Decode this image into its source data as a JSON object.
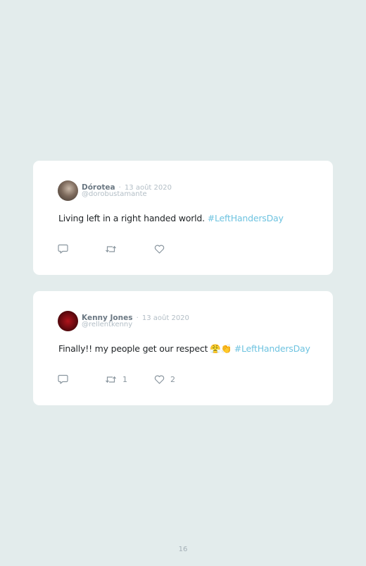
{
  "tweets": [
    {
      "author": "Dórotea",
      "separator": "·",
      "date": "13 août 2020",
      "handle": "@dorobustamante",
      "text": "Living left in a right handed world.",
      "hashtag": "#LeftHandersDay",
      "emoji": "",
      "retweets": "",
      "likes": ""
    },
    {
      "author": "Kenny Jones",
      "separator": "·",
      "date": "13 août 2020",
      "handle": "@rellentkenny",
      "text": "Finally!! my people get our respect",
      "emoji": "😤👏",
      "hashtag": "#LeftHandersDay",
      "retweets": "1",
      "likes": "2"
    }
  ],
  "page_number": "16",
  "colors": {
    "background": "#e3ecec",
    "card": "#ffffff",
    "hashtag": "#6ec3e0",
    "icon": "#8a969f"
  },
  "icons": {
    "reply": "reply-icon",
    "retweet": "retweet-icon",
    "like": "heart-icon"
  }
}
